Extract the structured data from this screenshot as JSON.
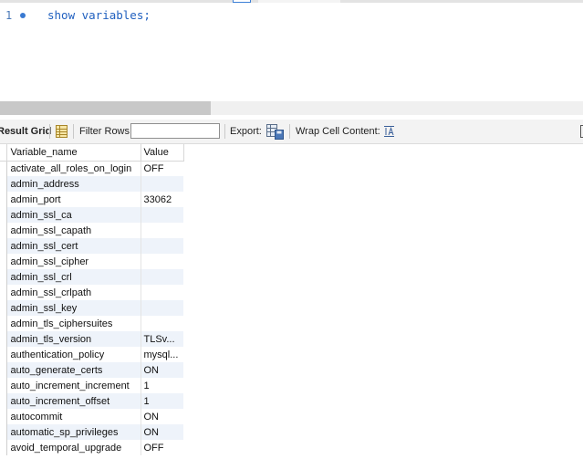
{
  "editor": {
    "line_number": "1",
    "code": "show variables;"
  },
  "toolbar": {
    "result_grid_label": "Result Grid",
    "filter_rows_label": "Filter Rows:",
    "filter_rows_value": "",
    "export_label": "Export:",
    "wrap_label": "Wrap Cell Content:"
  },
  "grid": {
    "columns": [
      "Variable_name",
      "Value"
    ],
    "rows": [
      {
        "name": "activate_all_roles_on_login",
        "value": "OFF"
      },
      {
        "name": "admin_address",
        "value": ""
      },
      {
        "name": "admin_port",
        "value": "33062"
      },
      {
        "name": "admin_ssl_ca",
        "value": ""
      },
      {
        "name": "admin_ssl_capath",
        "value": ""
      },
      {
        "name": "admin_ssl_cert",
        "value": ""
      },
      {
        "name": "admin_ssl_cipher",
        "value": ""
      },
      {
        "name": "admin_ssl_crl",
        "value": ""
      },
      {
        "name": "admin_ssl_crlpath",
        "value": ""
      },
      {
        "name": "admin_ssl_key",
        "value": ""
      },
      {
        "name": "admin_tls_ciphersuites",
        "value": ""
      },
      {
        "name": "admin_tls_version",
        "value": "TLSv..."
      },
      {
        "name": "authentication_policy",
        "value": "mysql..."
      },
      {
        "name": "auto_generate_certs",
        "value": "ON"
      },
      {
        "name": "auto_increment_increment",
        "value": "1"
      },
      {
        "name": "auto_increment_offset",
        "value": "1"
      },
      {
        "name": "autocommit",
        "value": "ON"
      },
      {
        "name": "automatic_sp_privileges",
        "value": "ON"
      },
      {
        "name": "avoid_temporal_upgrade",
        "value": "OFF"
      }
    ]
  }
}
